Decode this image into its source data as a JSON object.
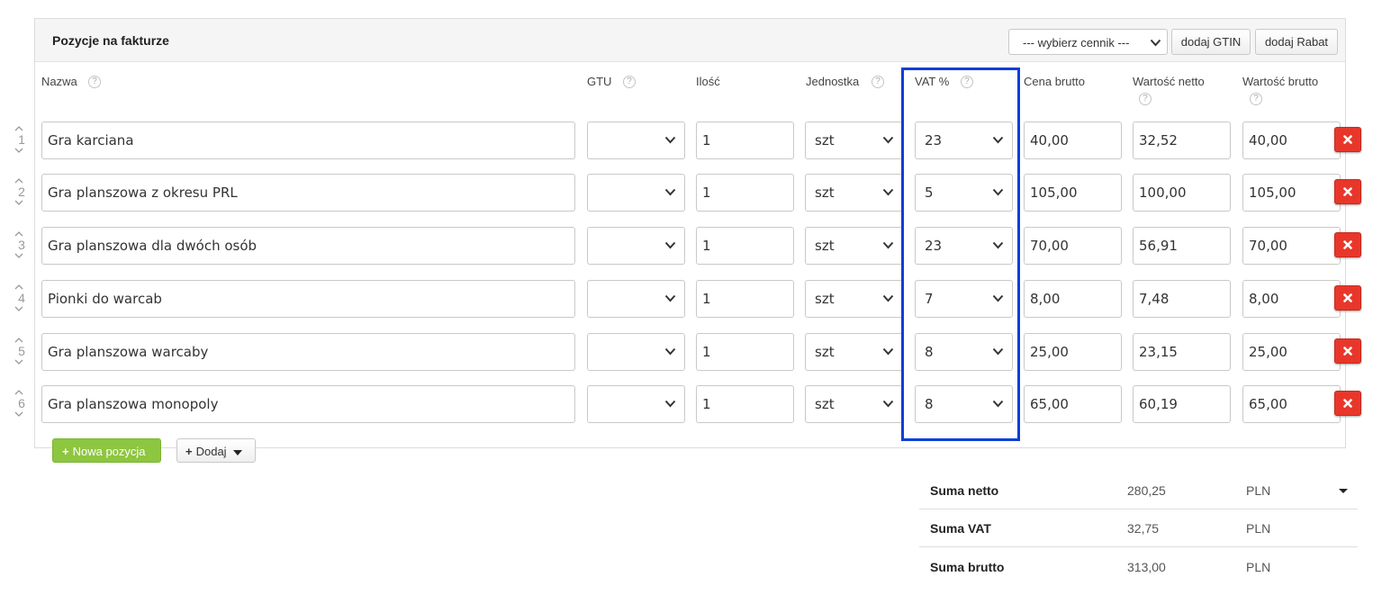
{
  "panel": {
    "title": "Pozycje na fakturze",
    "pricelist_select": "--- wybierz cennik ---",
    "add_gtin_label": "dodaj GTIN",
    "add_rabat_label": "dodaj Rabat"
  },
  "columns": {
    "nazwa": "Nazwa",
    "gtu": "GTU",
    "ilosc": "Ilość",
    "jednostka": "Jednostka",
    "vat": "VAT %",
    "cena_brutto": "Cena brutto",
    "wartosc_netto": "Wartość netto",
    "wartosc_brutto": "Wartość brutto"
  },
  "help_glyph": "?",
  "rows": [
    {
      "num": "1",
      "nazwa": "Gra karciana",
      "gtu": "",
      "ilosc": "1",
      "jednostka": "szt",
      "vat": "23",
      "cena_brutto": "40,00",
      "wartosc_netto": "32,52",
      "wartosc_brutto": "40,00"
    },
    {
      "num": "2",
      "nazwa": "Gra planszowa z okresu PRL",
      "gtu": "",
      "ilosc": "1",
      "jednostka": "szt",
      "vat": "5",
      "cena_brutto": "105,00",
      "wartosc_netto": "100,00",
      "wartosc_brutto": "105,00"
    },
    {
      "num": "3",
      "nazwa": "Gra planszowa dla dwóch osób",
      "gtu": "",
      "ilosc": "1",
      "jednostka": "szt",
      "vat": "23",
      "cena_brutto": "70,00",
      "wartosc_netto": "56,91",
      "wartosc_brutto": "70,00"
    },
    {
      "num": "4",
      "nazwa": "Pionki do warcab",
      "gtu": "",
      "ilosc": "1",
      "jednostka": "szt",
      "vat": "7",
      "cena_brutto": "8,00",
      "wartosc_netto": "7,48",
      "wartosc_brutto": "8,00"
    },
    {
      "num": "5",
      "nazwa": "Gra planszowa warcaby",
      "gtu": "",
      "ilosc": "1",
      "jednostka": "szt",
      "vat": "8",
      "cena_brutto": "25,00",
      "wartosc_netto": "23,15",
      "wartosc_brutto": "25,00"
    },
    {
      "num": "6",
      "nazwa": "Gra planszowa monopoly",
      "gtu": "",
      "ilosc": "1",
      "jednostka": "szt",
      "vat": "8",
      "cena_brutto": "65,00",
      "wartosc_netto": "60,19",
      "wartosc_brutto": "65,00"
    }
  ],
  "actions": {
    "new_item_label": "Nowa pozycja",
    "add_label": "Dodaj"
  },
  "summary": [
    {
      "label": "Suma netto",
      "value": "280,25",
      "currency": "PLN"
    },
    {
      "label": "Suma VAT",
      "value": "32,75",
      "currency": "PLN"
    },
    {
      "label": "Suma brutto",
      "value": "313,00",
      "currency": "PLN"
    }
  ],
  "colors": {
    "highlight": "#0a3fd8",
    "delete": "#e8372a",
    "new_item": "#8dc63f"
  }
}
